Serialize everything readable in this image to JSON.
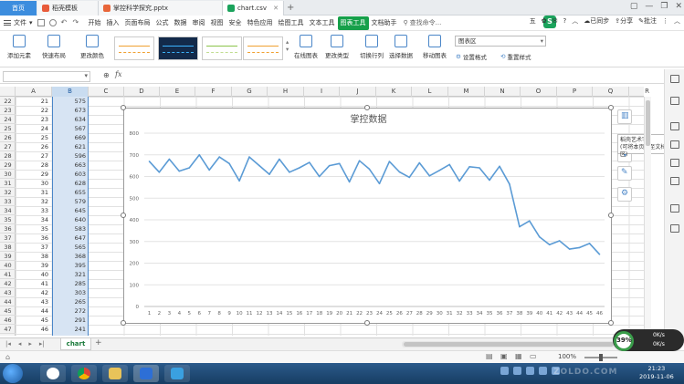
{
  "tabs": {
    "home": "首页",
    "template": "稻壳模板",
    "pptx": "掌控科学探究.pptx",
    "csv": "chart.csv"
  },
  "menubar": {
    "file": "文件",
    "items": [
      "开始",
      "插入",
      "页面布局",
      "公式",
      "数据",
      "审阅",
      "视图",
      "安全",
      "特色应用",
      "绘图工具",
      "文本工具",
      "图表工具",
      "文档助手"
    ],
    "active_index": 11,
    "search": "查找命令...",
    "sync": "已同步",
    "share": "分享",
    "comment": "批注",
    "user_badge": "五"
  },
  "ribbon": {
    "add_element": "添加元素",
    "quick_layout": "快速布局",
    "change_color": "更改颜色",
    "online_chart": "在线图表",
    "change_type": "更改类型",
    "switch_row_col": "切换行列",
    "select_data": "选择数据",
    "move_chart": "移动图表",
    "set_format": "设置格式",
    "reset_style": "重置样式",
    "chart_area": "图表区"
  },
  "formula_bar": {
    "fx": "fx",
    "zoom": "⊕"
  },
  "columns": [
    "A",
    "B",
    "C",
    "D",
    "E",
    "F",
    "G",
    "H",
    "I",
    "J",
    "K",
    "L",
    "M",
    "N",
    "O",
    "P",
    "Q",
    "R"
  ],
  "rows": [
    {
      "row": "22",
      "a": "21",
      "b": "575"
    },
    {
      "row": "23",
      "a": "22",
      "b": "673"
    },
    {
      "row": "24",
      "a": "23",
      "b": "634"
    },
    {
      "row": "25",
      "a": "24",
      "b": "567"
    },
    {
      "row": "26",
      "a": "25",
      "b": "669"
    },
    {
      "row": "27",
      "a": "26",
      "b": "621"
    },
    {
      "row": "28",
      "a": "27",
      "b": "596"
    },
    {
      "row": "29",
      "a": "28",
      "b": "663"
    },
    {
      "row": "30",
      "a": "29",
      "b": "603"
    },
    {
      "row": "31",
      "a": "30",
      "b": "628"
    },
    {
      "row": "32",
      "a": "31",
      "b": "655"
    },
    {
      "row": "33",
      "a": "32",
      "b": "579"
    },
    {
      "row": "34",
      "a": "33",
      "b": "645"
    },
    {
      "row": "35",
      "a": "34",
      "b": "640"
    },
    {
      "row": "36",
      "a": "35",
      "b": "583"
    },
    {
      "row": "37",
      "a": "36",
      "b": "647"
    },
    {
      "row": "38",
      "a": "37",
      "b": "565"
    },
    {
      "row": "39",
      "a": "38",
      "b": "368"
    },
    {
      "row": "40",
      "a": "39",
      "b": "395"
    },
    {
      "row": "41",
      "a": "40",
      "b": "321"
    },
    {
      "row": "42",
      "a": "41",
      "b": "285"
    },
    {
      "row": "43",
      "a": "42",
      "b": "303"
    },
    {
      "row": "44",
      "a": "43",
      "b": "265"
    },
    {
      "row": "45",
      "a": "44",
      "b": "272"
    },
    {
      "row": "46",
      "a": "45",
      "b": "291"
    },
    {
      "row": "47",
      "a": "46",
      "b": "241"
    }
  ],
  "chart_data": {
    "type": "line",
    "title": "掌控数据",
    "xlabel": "",
    "ylabel": "",
    "x": [
      1,
      2,
      3,
      4,
      5,
      6,
      7,
      8,
      9,
      10,
      11,
      12,
      13,
      14,
      15,
      16,
      17,
      18,
      19,
      20,
      21,
      22,
      23,
      24,
      25,
      26,
      27,
      28,
      29,
      30,
      31,
      32,
      33,
      34,
      35,
      36,
      37,
      38,
      39,
      40,
      41,
      42,
      43,
      44,
      45,
      46
    ],
    "series": [
      {
        "values": [
          670,
          620,
          680,
          625,
          640,
          700,
          630,
          690,
          660,
          580,
          690,
          650,
          610,
          680,
          620,
          640,
          665,
          600,
          650,
          660,
          575,
          673,
          634,
          567,
          669,
          621,
          596,
          663,
          603,
          628,
          655,
          579,
          645,
          640,
          583,
          647,
          565,
          368,
          395,
          321,
          285,
          303,
          265,
          272,
          291,
          241
        ],
        "color": "#5b9bd5"
      }
    ],
    "ylim": [
      0,
      800
    ],
    "yticks": [
      0,
      100,
      200,
      300,
      400,
      500,
      600,
      700,
      800
    ],
    "grid": true,
    "legend": "none"
  },
  "tooltip": {
    "line1": "稻壳艺术字",
    "line2": "(可将本页面至文档区)"
  },
  "sheet": {
    "tab": "chart",
    "add": "+"
  },
  "status": {
    "zoom": "100%"
  },
  "speed_widget": {
    "percent": "39%",
    "up": "0K/s",
    "down": "0K/s"
  },
  "taskbar": {
    "time": "21:23",
    "date": "2019-11-06",
    "watermark": "ZOLDO.COM"
  }
}
